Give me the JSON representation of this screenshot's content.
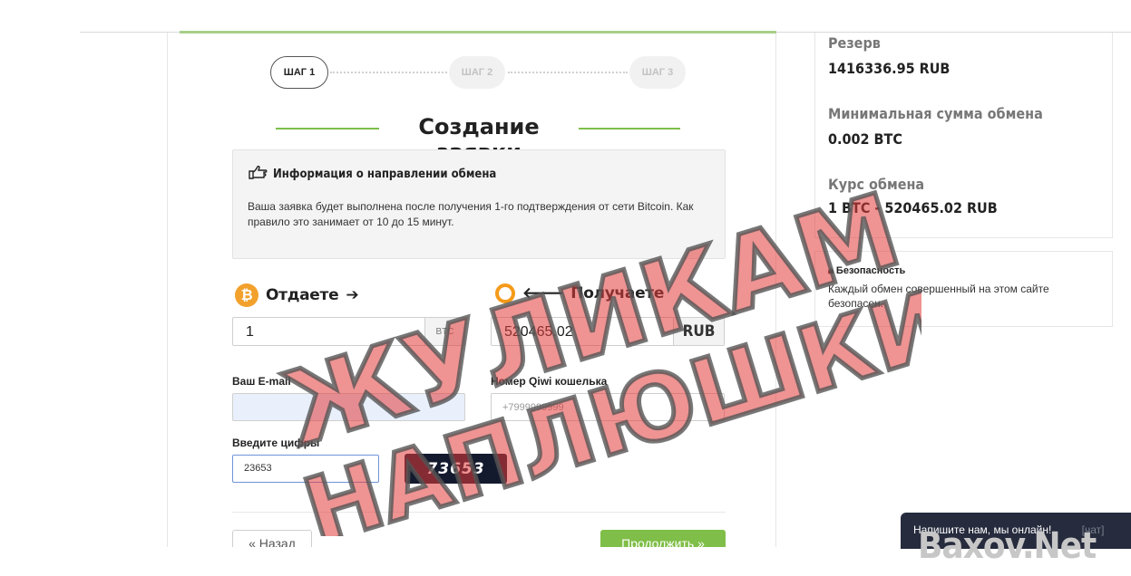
{
  "steps": [
    "ШАГ 1",
    "ШАГ 2",
    "ШАГ 3"
  ],
  "title": "Создание заявки",
  "info": {
    "heading": "Информация о направлении обмена",
    "text": "Ваша заявка будет выполнена после получения 1-го подтверждения от сети Bitcoin. Как правило это занимает от 10 до 15 минут."
  },
  "give": {
    "label": "Отдаете",
    "value": "1",
    "currency": "BTC"
  },
  "get": {
    "label": "Получаете",
    "value": "520465.02",
    "currency": "RUB"
  },
  "email": {
    "label": "Ваш E-mail",
    "value": ""
  },
  "qiwi": {
    "label": "Номер Qiwi кошелька",
    "placeholder": "+7999999999"
  },
  "captcha": {
    "label": "Введите цифры",
    "value": "23653",
    "image_text": "73653"
  },
  "buttons": {
    "back": "« Назад",
    "next": "Продолжить »"
  },
  "sidebar": {
    "reserve_label": "Резерв",
    "reserve_value": "1416336.95 RUB",
    "min_label": "Минимальная сумма обмена",
    "min_value": "0.002 BTC",
    "rate_label": "Курс обмена",
    "rate_value": "1 BTC - 520465.02 RUB"
  },
  "security": {
    "heading": "Безопасность",
    "text": "Каждый обмен совершенный на этом сайте безопасен."
  },
  "chat": {
    "text": "Напишите нам, мы онлайн!",
    "extra": "[чат]"
  },
  "stamp": {
    "line1": "ЖУЛИКАМ",
    "line2": "НАПЛЮШКИ"
  },
  "watermark": "Baxov.Net",
  "colors": {
    "green": "#7fbe48",
    "bitcoin": "#f2a12c",
    "qiwi": "#f59a19",
    "stamp": "#e23b3b"
  }
}
